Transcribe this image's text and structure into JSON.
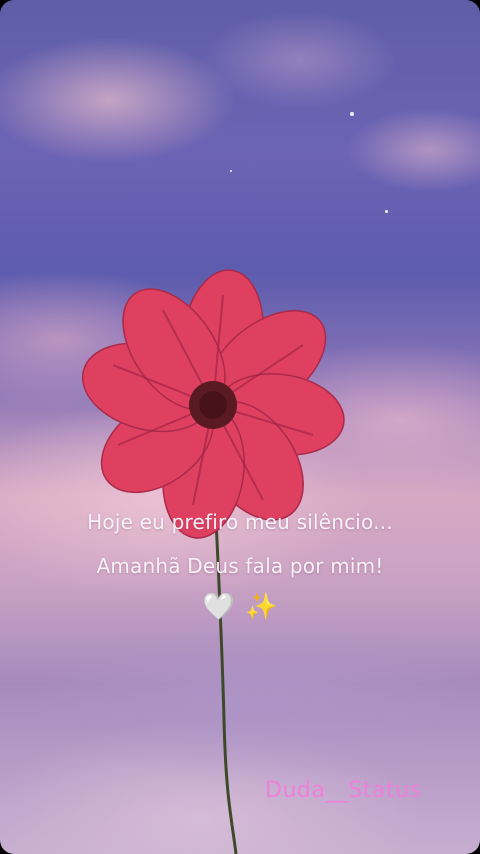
{
  "quote": {
    "line1": "Hoje eu prefiro meu silêncio...",
    "line2": "Amanhã Deus fala por mim!"
  },
  "emojis": {
    "heart": "🤍",
    "sparkles": "✨"
  },
  "watermark": "Duda__Status",
  "colors": {
    "petal": "#e0405f",
    "flower_center": "#5a1a22",
    "watermark": "#f07fdc"
  }
}
